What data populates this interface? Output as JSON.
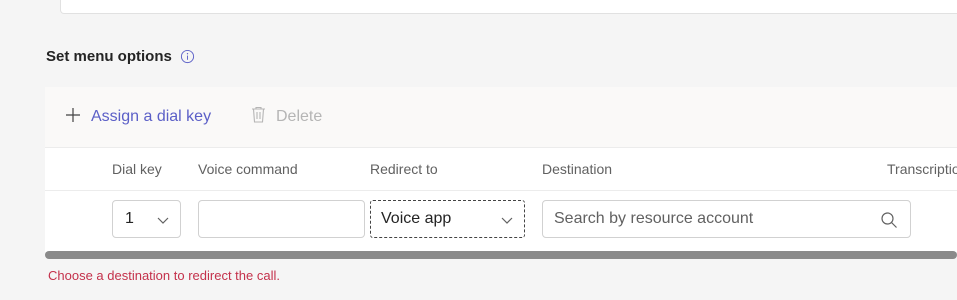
{
  "section": {
    "title": "Set menu options"
  },
  "toolbar": {
    "assign_label": "Assign a dial key",
    "delete_label": "Delete"
  },
  "table": {
    "headers": [
      "Dial key",
      "Voice command",
      "Redirect to",
      "Destination",
      "Transcriptio"
    ],
    "row": {
      "dial_key": "1",
      "voice_command": "",
      "redirect_to": "Voice app",
      "destination_placeholder": "Search by resource account"
    }
  },
  "error": "Choose a destination to redirect the call.",
  "colors": {
    "accent": "#5b5fc7",
    "error": "#c4314b"
  }
}
